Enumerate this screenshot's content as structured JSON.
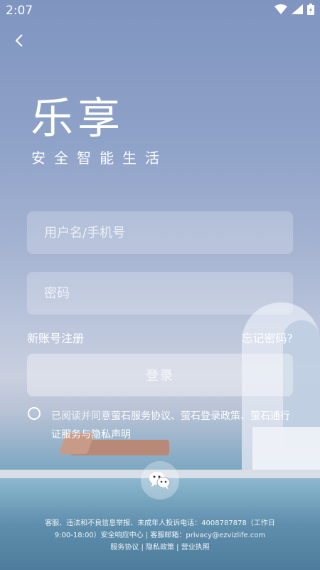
{
  "status": {
    "time": "2:07"
  },
  "brand": {
    "title": "乐享",
    "slogan": "安全智能生活"
  },
  "form": {
    "username_placeholder": "用户名/手机号",
    "password_placeholder": "密码",
    "register_label": "新账号注册",
    "forgot_label": "忘记密码?",
    "login_label": "登录"
  },
  "agreement": {
    "prefix": "已阅读并同意",
    "links": "萤石服务协议、萤石登录政策、萤石通行证服务与隐私声明"
  },
  "footer": {
    "line1": "客服、违法和不良信息举报、未成年人投诉电话：4008787878（工作日",
    "line2": "9:00-18:00）安全响应中心 | 客服邮箱：privacy@ezvizlife.com",
    "link_service": "服务协议",
    "link_privacy": "隐私政策",
    "link_license": "营业执照"
  }
}
